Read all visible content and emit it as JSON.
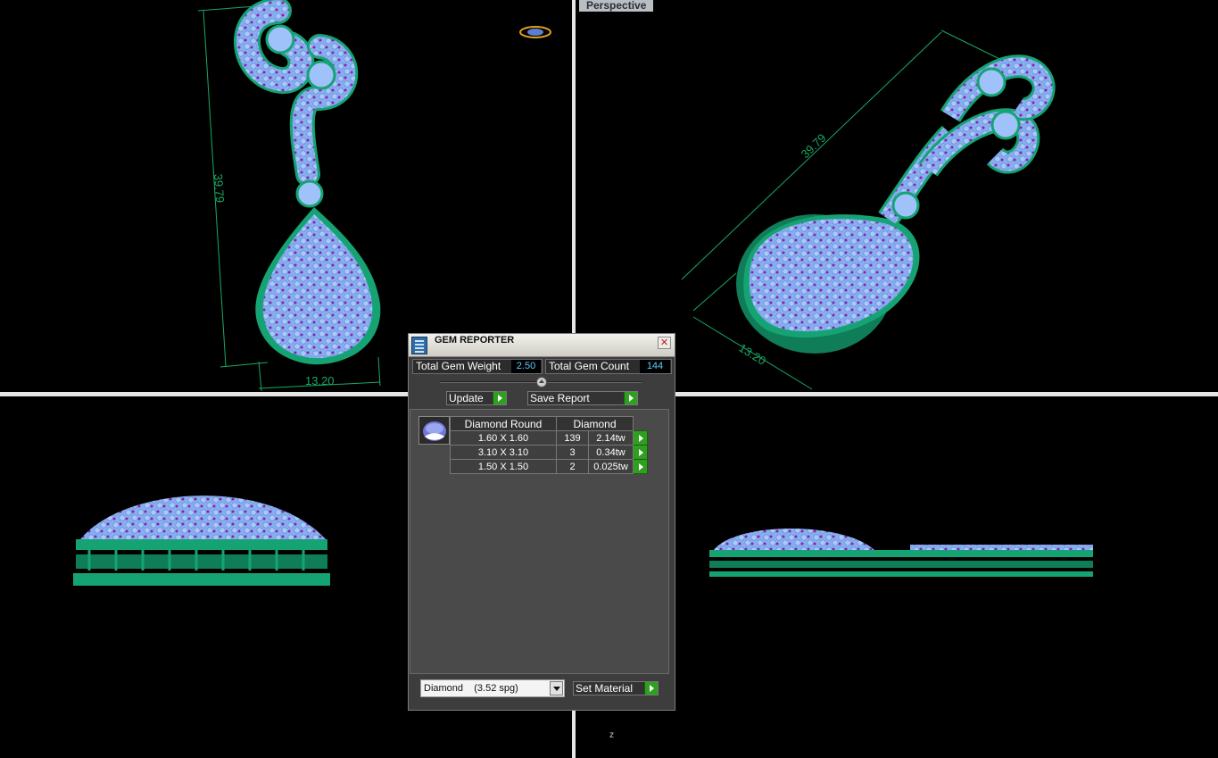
{
  "viewports": {
    "top_right_label": "Perspective",
    "bottom_right_axis": "z"
  },
  "dimensions": {
    "front_height": "39.79",
    "front_width": "13.20",
    "perspective_height": "39.79",
    "perspective_width": "13.20"
  },
  "gem_reporter": {
    "title": "GEM REPORTER",
    "close_glyph": "✕",
    "total_weight_label": "Total Gem Weight",
    "total_weight_value": "2.50",
    "total_count_label": "Total Gem Count",
    "total_count_value": "144",
    "update_label": "Update",
    "save_report_label": "Save Report",
    "table": {
      "headers": [
        "Diamond Round",
        "Diamond"
      ],
      "rows": [
        {
          "size": "1.60 X 1.60",
          "count": "139",
          "weight": "2.14tw"
        },
        {
          "size": "3.10 X 3.10",
          "count": "3",
          "weight": "0.34tw"
        },
        {
          "size": "1.50 X 1.50",
          "count": "2",
          "weight": "0.025tw"
        }
      ]
    },
    "material_select": "Diamond    (3.52 spg)",
    "set_material_label": "Set Material"
  },
  "colors": {
    "metal": "#16a374",
    "gem": "#8fb6f5",
    "prong": "#8a1fb0",
    "dimension_line": "#1aa865",
    "action_green": "#2e9f1e"
  },
  "icons": {
    "app": "gem-reporter-icon",
    "close": "close-icon",
    "go": "play-arrow-icon",
    "gem_preview": "diamond-round-icon",
    "dropdown": "chevron-down-icon"
  }
}
